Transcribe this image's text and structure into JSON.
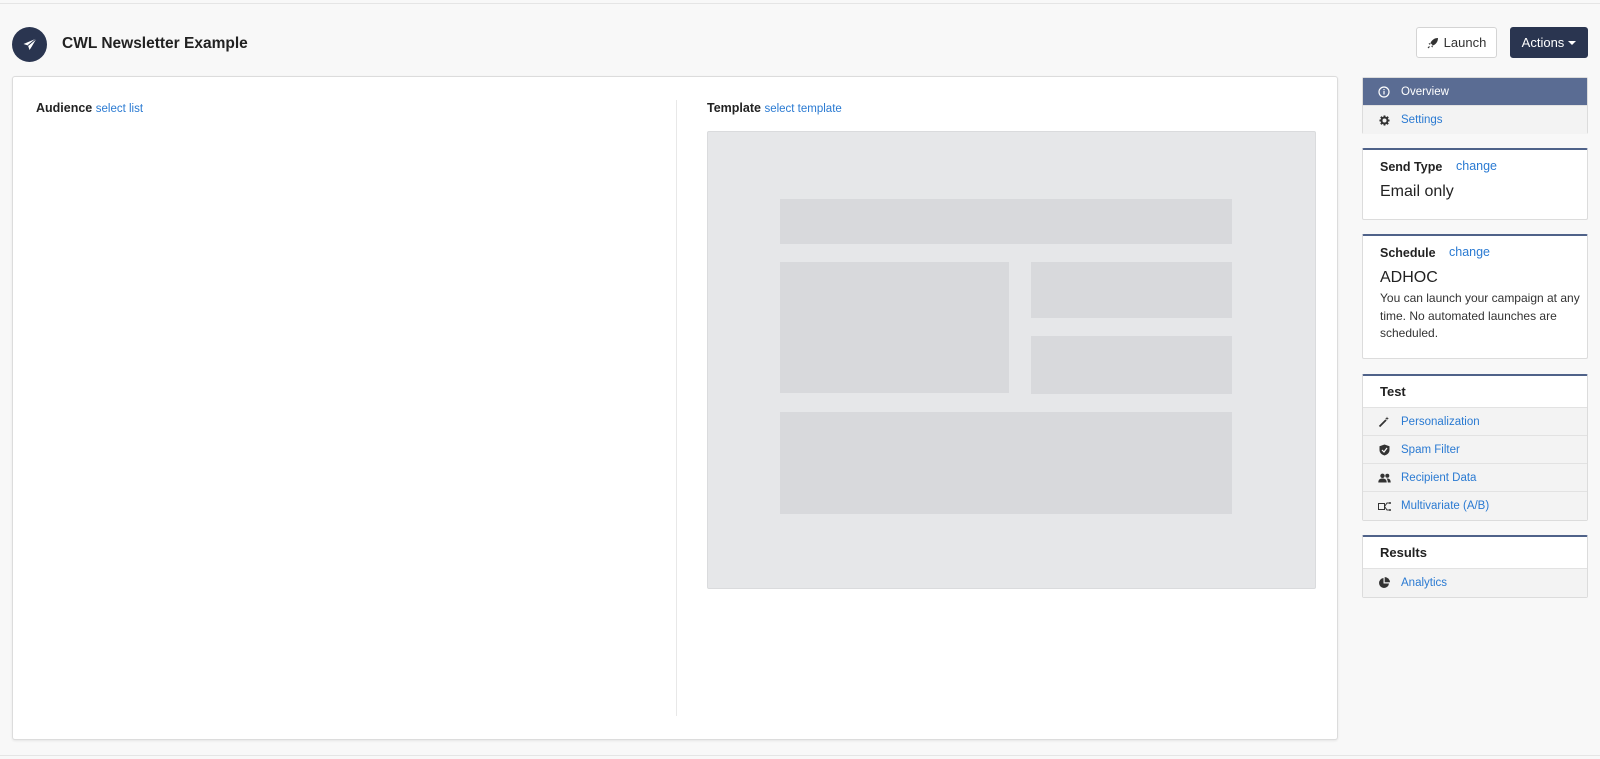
{
  "header": {
    "title": "CWL Newsletter Example",
    "launch_label": "Launch",
    "actions_label": "Actions"
  },
  "audience": {
    "label": "Audience",
    "link": "select list"
  },
  "template": {
    "label": "Template",
    "link": "select template"
  },
  "sidebar": {
    "nav": [
      {
        "label": "Overview",
        "icon": "info-circle-icon",
        "active": true
      },
      {
        "label": "Settings",
        "icon": "gear-icon",
        "active": false
      }
    ],
    "send_type": {
      "label": "Send Type",
      "change": "change",
      "value": "Email only"
    },
    "schedule": {
      "label": "Schedule",
      "change": "change",
      "value": "ADHOC",
      "description": "You can launch your campaign at any time. No automated launches are scheduled."
    },
    "test": {
      "label": "Test",
      "items": [
        {
          "label": "Personalization",
          "icon": "magic-wand-icon"
        },
        {
          "label": "Spam Filter",
          "icon": "shield-icon"
        },
        {
          "label": "Recipient Data",
          "icon": "users-icon"
        },
        {
          "label": "Multivariate (A/B)",
          "icon": "split-icon"
        }
      ]
    },
    "results": {
      "label": "Results",
      "items": [
        {
          "label": "Analytics",
          "icon": "pie-chart-icon"
        }
      ]
    }
  },
  "colors": {
    "navy": "#2a3550",
    "nav_active": "#5a6c93",
    "link": "#2a7ad2",
    "card_top_border": "#4f6289"
  }
}
